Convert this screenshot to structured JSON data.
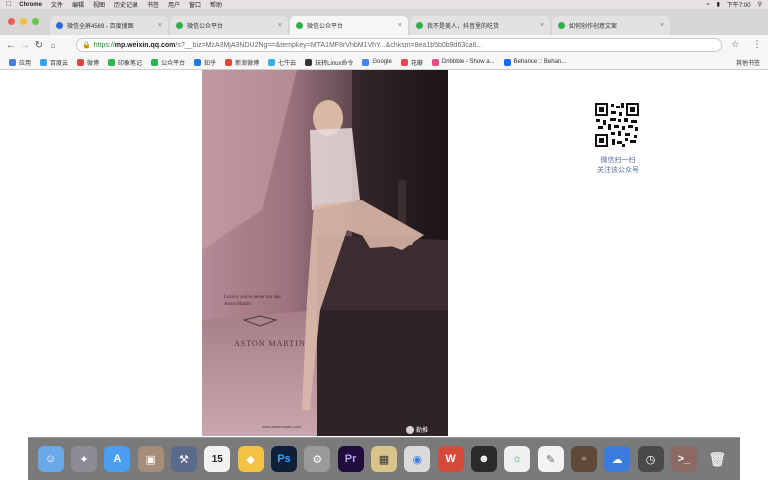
{
  "menubar": {
    "apple_icon": "apple-icon",
    "items": [
      "Chrome",
      "文件",
      "编辑",
      "视图",
      "历史记录",
      "书签",
      "用户",
      "窗口",
      "帮助"
    ],
    "clock": "下午7:00"
  },
  "tabs": [
    {
      "label": "微信全屏4569 - 百度搜图",
      "active": false
    },
    {
      "label": "微信公众平台",
      "active": false
    },
    {
      "label": "微信公众平台",
      "active": true
    },
    {
      "label": "我不是美人，抖音里的吃货",
      "active": false
    },
    {
      "label": "如何创作创意文案",
      "active": false
    }
  ],
  "toolbar": {
    "back_icon": "back-arrow-icon",
    "forward_icon": "forward-arrow-icon",
    "reload_icon": "reload-icon",
    "home_icon": "home-icon",
    "url_scheme": "https://",
    "url_host": "mp.weixin.qq.com",
    "url_path": "/s?__biz=MzA3MjA3NDU2Ng==&tempkey=MTA1MF8rVhbM1VhY...&chksm=8ea1b5b0b9d63ca6...",
    "star_icon": "bookmark-star-icon",
    "menu_icon": "kebab-menu-icon"
  },
  "bookmarks": {
    "items": [
      {
        "label": "应用",
        "color": "#4a7fd6"
      },
      {
        "label": "百度云",
        "color": "#3aa0e8"
      },
      {
        "label": "微博",
        "color": "#e0463b"
      },
      {
        "label": "印象笔记",
        "color": "#2db84b"
      },
      {
        "label": "公众平台",
        "color": "#2bb24c"
      },
      {
        "label": "知乎",
        "color": "#1f7be0"
      },
      {
        "label": "新浪微博",
        "color": "#e0463b"
      },
      {
        "label": "七牛云",
        "color": "#3ab0e0"
      },
      {
        "label": "玩转Linux命令",
        "color": "#333333"
      },
      {
        "label": "Google",
        "color": "#4285f4"
      },
      {
        "label": "花瓣",
        "color": "#e8454f"
      },
      {
        "label": "Dribbble - Show a...",
        "color": "#ea4c89"
      },
      {
        "label": "Behance :: Behan...",
        "color": "#1769ff"
      }
    ],
    "other": "其他书签"
  },
  "article": {
    "ad_lines": [
      "Luxury you're never too late",
      "Aston Martin"
    ],
    "logo_text": "ASTON MARTIN",
    "footer_url": "www.astonmartin.com",
    "watermark": "勒推"
  },
  "qr": {
    "caption_line1": "微信扫一扫",
    "caption_line2": "关注该公众号"
  },
  "dock": {
    "items": [
      "finder-icon",
      "launchpad-icon",
      "app-store-icon",
      "preview-icon",
      "xcode-icon",
      "calendar-icon",
      "sketch-icon",
      "photoshop-icon",
      "settings-icon",
      "premiere-icon",
      "keynote-icon",
      "chrome-icon",
      "wps-icon",
      "qq-icon",
      "wechat-icon",
      "notes-icon",
      "screen-icon",
      "baidu-netdisk-icon",
      "time-machine-icon",
      "terminal-icon",
      "trash-icon"
    ]
  }
}
